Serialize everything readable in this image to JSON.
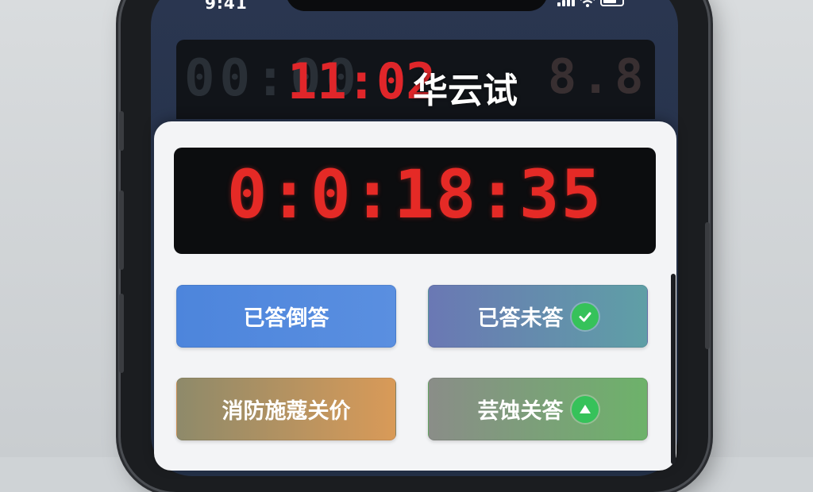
{
  "status_bar": {
    "time": "9:41",
    "icons": [
      "signal-icon",
      "wifi-icon",
      "battery-icon"
    ]
  },
  "top_clock": {
    "ghost_digits": "00:00",
    "ghost_right": "8.8",
    "time": "11:02",
    "title": "华云试"
  },
  "timer": {
    "value": "0:0:18:35",
    "color": "#e52a26"
  },
  "buttons": [
    {
      "label": "已答倒答",
      "badge": null
    },
    {
      "label": "已答未答",
      "badge": "check-icon"
    },
    {
      "label": "消防施蔻关价",
      "badge": null
    },
    {
      "label": "芸蚀关答",
      "badge": "triangle-up-icon"
    }
  ],
  "colors": {
    "accent_green": "#36c25a",
    "timer_red": "#e52a26"
  }
}
